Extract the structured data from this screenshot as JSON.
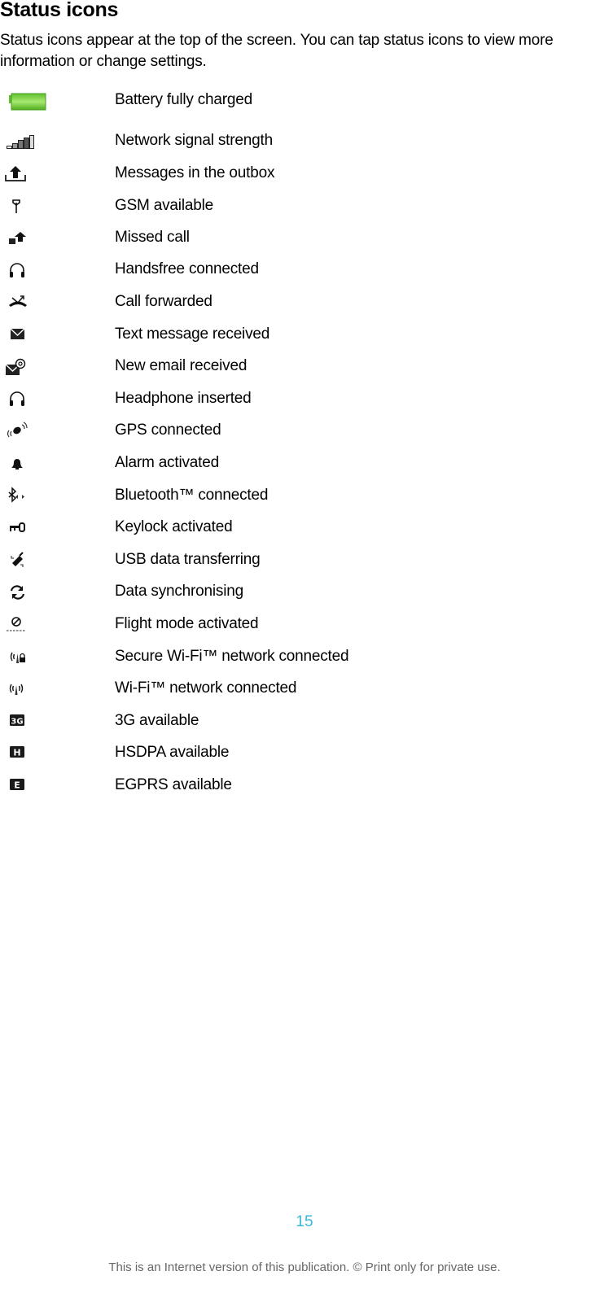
{
  "page": {
    "title": "Status icons",
    "intro": "Status icons appear at the top of the screen. You can tap status icons to view more information or change settings.",
    "page_number": "15",
    "footer": "This is an Internet version of this publication. © Print only for private use.",
    "accent_color": "#3ab7d9"
  },
  "icons": [
    {
      "icon": "battery-full-icon",
      "label": "Battery fully charged"
    },
    {
      "icon": "signal-strength-icon",
      "label": "Network signal strength"
    },
    {
      "icon": "outbox-icon",
      "label": "Messages in the outbox"
    },
    {
      "icon": "gsm-antenna-icon",
      "label": "GSM available"
    },
    {
      "icon": "missed-call-icon",
      "label": "Missed call"
    },
    {
      "icon": "handsfree-icon",
      "label": "Handsfree connected"
    },
    {
      "icon": "call-forwarded-icon",
      "label": "Call forwarded"
    },
    {
      "icon": "envelope-icon",
      "label": "Text message received"
    },
    {
      "icon": "email-at-icon",
      "label": "New email received"
    },
    {
      "icon": "headphone-icon",
      "label": "Headphone inserted"
    },
    {
      "icon": "gps-satellite-icon",
      "label": "GPS connected"
    },
    {
      "icon": "alarm-bell-icon",
      "label": "Alarm activated"
    },
    {
      "icon": "bluetooth-icon",
      "label": "Bluetooth™ connected"
    },
    {
      "icon": "key-icon",
      "label": "Keylock activated"
    },
    {
      "icon": "usb-plug-icon",
      "label": "USB data transferring"
    },
    {
      "icon": "sync-icon",
      "label": "Data synchronising"
    },
    {
      "icon": "flight-mode-icon",
      "label": "Flight mode activated"
    },
    {
      "icon": "wifi-secure-icon",
      "label": "Secure Wi-Fi™ network connected"
    },
    {
      "icon": "wifi-icon",
      "label": "Wi-Fi™ network connected"
    },
    {
      "icon": "3g-badge-icon",
      "label": "3G available",
      "badge": "3G"
    },
    {
      "icon": "hsdpa-badge-icon",
      "label": "HSDPA available",
      "badge": "H"
    },
    {
      "icon": "egprs-badge-icon",
      "label": "EGPRS available",
      "badge": "E"
    }
  ]
}
